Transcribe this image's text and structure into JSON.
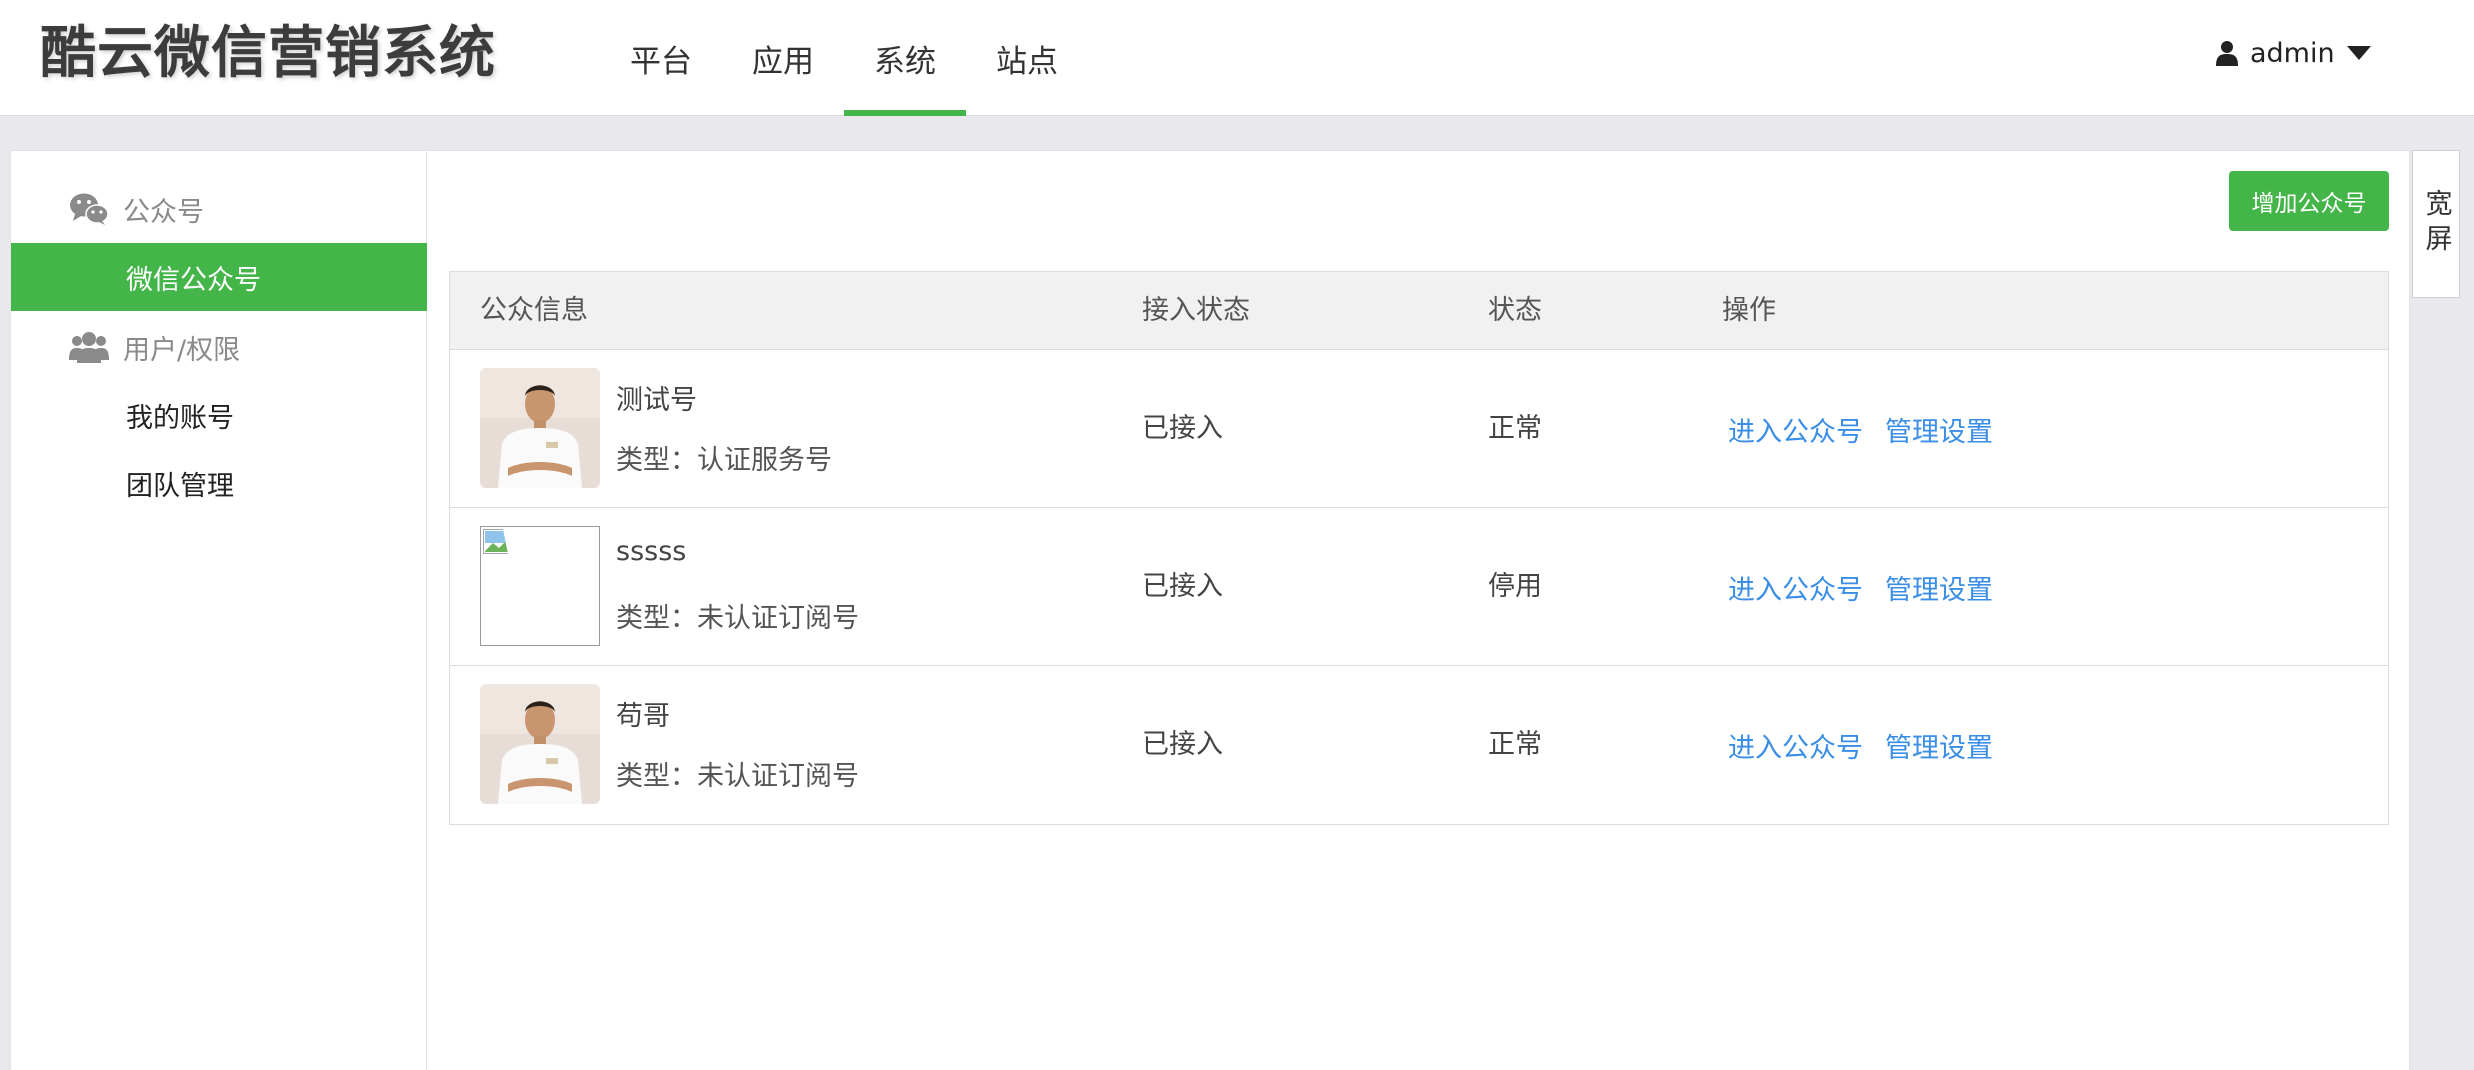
{
  "brand": {
    "logo_text": "酷云微信营销系统"
  },
  "topnav": {
    "items": [
      {
        "label": "平台"
      },
      {
        "label": "应用"
      },
      {
        "label": "系统",
        "active": true
      },
      {
        "label": "站点"
      }
    ]
  },
  "user": {
    "name": "admin"
  },
  "sidebar": {
    "group_accounts": "公众号",
    "item_wechat_accounts": "微信公众号",
    "group_users": "用户/权限",
    "item_my_account": "我的账号",
    "item_team": "团队管理"
  },
  "toolbar": {
    "add_label": "增加公众号"
  },
  "side_tab": {
    "label": "宽屏"
  },
  "table": {
    "headers": [
      "公众信息",
      "接入状态",
      "状态",
      "操作"
    ],
    "rows": [
      {
        "name": "测试号",
        "type": "类型：认证服务号",
        "access": "已接入",
        "status": "正常",
        "op_enter": "进入公众号",
        "op_manage": "管理设置",
        "avatar": "photo"
      },
      {
        "name": "sssss",
        "type": "类型：未认证订阅号",
        "access": "已接入",
        "status": "停用",
        "op_enter": "进入公众号",
        "op_manage": "管理设置",
        "avatar": "broken-image"
      },
      {
        "name": "苟哥",
        "type": "类型：未认证订阅号",
        "access": "已接入",
        "status": "正常",
        "op_enter": "进入公众号",
        "op_manage": "管理设置",
        "avatar": "photo"
      }
    ]
  },
  "colors": {
    "accent": "#44b549",
    "link": "#3a8ee6",
    "background": "#e9e9ed"
  }
}
